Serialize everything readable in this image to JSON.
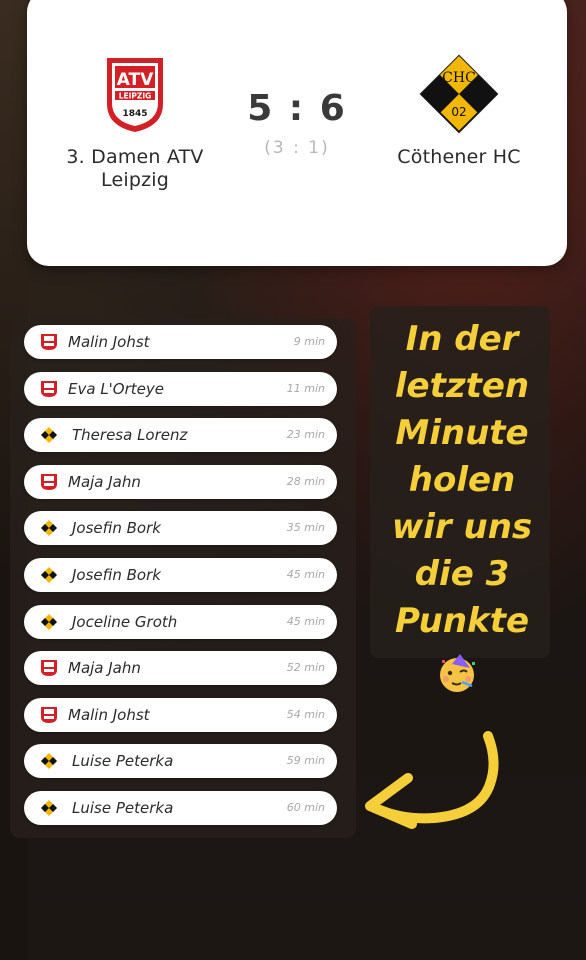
{
  "match": {
    "home_team": "3. Damen ATV Leipzig",
    "away_team": "Cöthener HC",
    "score": "5 : 6",
    "halftime": "(3 : 1)",
    "home_logo": {
      "text_top": "ATV",
      "text_mid": "LEIPZIG",
      "text_bottom": "1845",
      "color": "#d32027"
    },
    "away_logo": {
      "text_top": "CHC",
      "text_mid": "02",
      "color": "#f2b705"
    }
  },
  "goals": [
    {
      "team": "home",
      "player": "Malin Johst",
      "time": "9 min"
    },
    {
      "team": "home",
      "player": "Eva L'Orteye",
      "time": "11 min"
    },
    {
      "team": "away",
      "player": "Theresa Lorenz",
      "time": "23 min"
    },
    {
      "team": "home",
      "player": "Maja Jahn",
      "time": "28 min"
    },
    {
      "team": "away",
      "player": "Josefin Bork",
      "time": "35 min"
    },
    {
      "team": "away",
      "player": "Josefin Bork",
      "time": "45 min"
    },
    {
      "team": "away",
      "player": "Joceline Groth",
      "time": "45 min"
    },
    {
      "team": "home",
      "player": "Maja Jahn",
      "time": "52 min"
    },
    {
      "team": "home",
      "player": "Malin Johst",
      "time": "54 min"
    },
    {
      "team": "away",
      "player": "Luise Peterka",
      "time": "59 min"
    },
    {
      "team": "away",
      "player": "Luise Peterka",
      "time": "60 min"
    }
  ],
  "message": {
    "lines": [
      "In der",
      "letzten",
      "Minute",
      "holen",
      "wir uns",
      "die 3",
      "Punkte"
    ],
    "color": "#f5cf3a",
    "emoji": "partying-face-emoji"
  }
}
